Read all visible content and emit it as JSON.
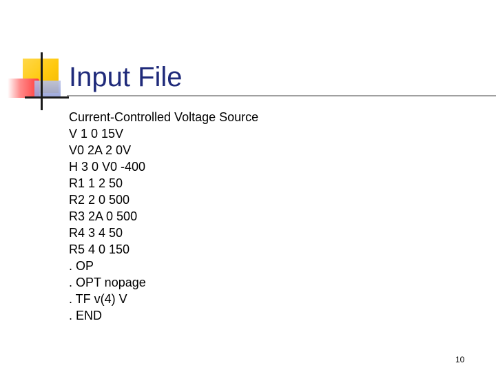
{
  "slide": {
    "title": "Input File",
    "lines": [
      "Current-Controlled Voltage Source",
      "V 1 0 15V",
      "V0 2A 2 0V",
      "H 3 0 V0 -400",
      "R1 1 2 50",
      "R2 2 0 500",
      "R3 2A 0 500",
      "R4 3 4 50",
      "R5 4 0 150",
      ". OP",
      ". OPT nopage",
      ". TF v(4) V",
      ". END"
    ],
    "page_number": "10"
  },
  "colors": {
    "title": "#1f2a7a",
    "accent_yellow": "#ffc90e",
    "accent_red": "#ff3b3b",
    "accent_blue": "#8f9bd6",
    "rule": "#a0a0a0"
  }
}
